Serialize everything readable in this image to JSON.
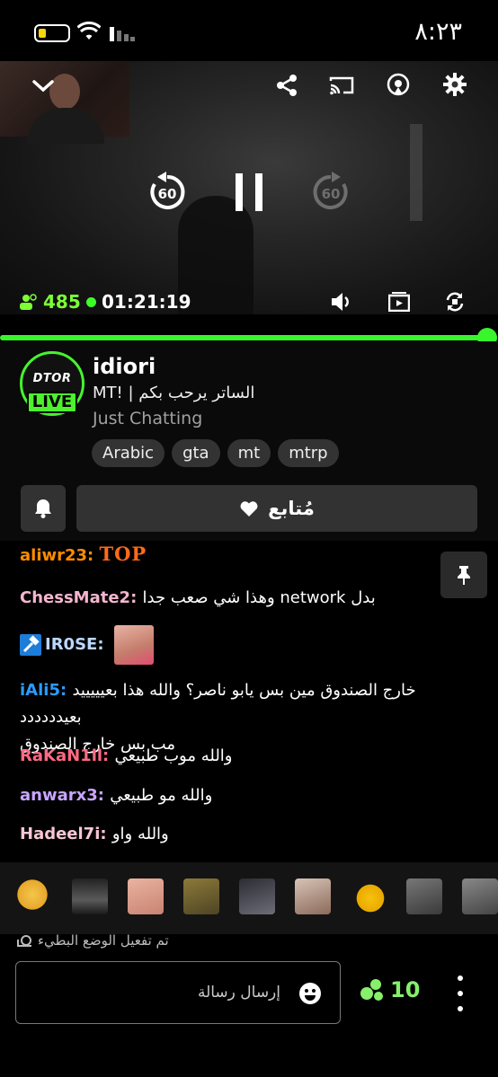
{
  "status_bar": {
    "time": "٨:٢٣"
  },
  "player": {
    "viewer_count": "485",
    "uptime": "01:21:19",
    "rewind_seconds": "60",
    "forward_seconds": "60"
  },
  "channel": {
    "avatar_text": "DTOR",
    "live_label": "LIVE",
    "name": "idiori",
    "stream_title": "MT! | الساتر يرحب بكم",
    "category": "Just Chatting",
    "tags": [
      "Arabic",
      "gta",
      "mt",
      "mtrp"
    ]
  },
  "follow": {
    "label": "مُتابع"
  },
  "chat": {
    "messages": [
      {
        "user": "aliwr23",
        "text": "TOP",
        "color": "#ff8c00"
      },
      {
        "user": "ChessMate2",
        "text": "وهذا شي صعب جدا network بدل",
        "color": "#f5b5cf"
      },
      {
        "user": "IR0SE",
        "text": "",
        "color": "#bcd7ff"
      },
      {
        "user": "iAli5",
        "text": "خارج الصندوق مين بس يابو ناصر؟ والله هذا بعيييييد بعيدددددد",
        "text2": "مب بس خارج الصندوق",
        "color": "#2b9bff"
      },
      {
        "user": "RaKaN1ll",
        "text": "والله موب طبيعي",
        "color": "#ff6a84"
      },
      {
        "user": "anwarx3",
        "text": "والله مو طبيعي",
        "color": "#c9a6ff"
      },
      {
        "user": "Hadeel7i",
        "text": "والله واو",
        "color": "#f7c6d4"
      }
    ]
  },
  "slow_mode": "تم تفعيل الوضع البطيء",
  "input": {
    "placeholder": "إرسال رسالة"
  },
  "points": "10",
  "colors": {
    "accent": "#39f52b",
    "live": "#4df22d"
  }
}
